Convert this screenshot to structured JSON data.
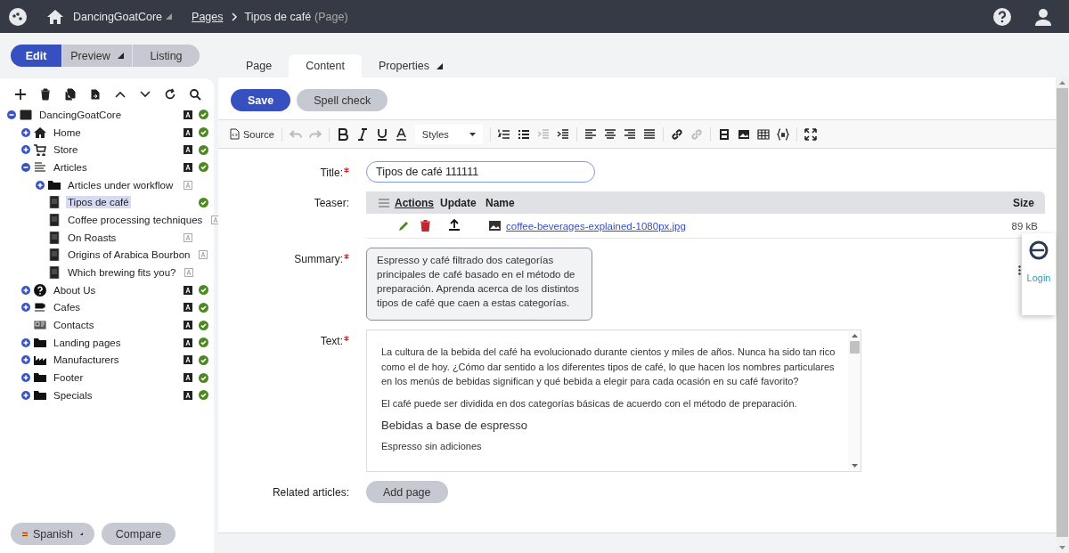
{
  "header": {
    "site": "DancingGoatCore",
    "breadcrumb": [
      {
        "label": "Pages",
        "kind": "link"
      },
      {
        "label": "Tipos de café",
        "kind": "current"
      }
    ],
    "page_type": "(Page)"
  },
  "mode_tabs": [
    {
      "label": "Edit",
      "selected": true,
      "dropdown": false
    },
    {
      "label": "Preview",
      "selected": false,
      "dropdown": true
    },
    {
      "label": "Listing",
      "selected": false,
      "dropdown": false
    }
  ],
  "tree": [
    {
      "label": "DancingGoatCore",
      "kind": "site",
      "expanded": true,
      "translated": true,
      "published": true,
      "selected": false,
      "children": [
        {
          "label": "Home",
          "kind": "home",
          "expanded": false,
          "translated": true,
          "published": true,
          "selected": false
        },
        {
          "label": "Store",
          "kind": "cart",
          "expanded": false,
          "translated": true,
          "published": true,
          "selected": false
        },
        {
          "label": "Articles",
          "kind": "list",
          "expanded": true,
          "translated": true,
          "published": true,
          "selected": false,
          "children": [
            {
              "label": "Articles under workflow",
              "kind": "folder",
              "expanded": false,
              "translated": false,
              "published": false,
              "selected": false
            },
            {
              "label": "Tipos de café",
              "kind": "page",
              "published": true,
              "selected": true
            },
            {
              "label": "Coffee processing techniques",
              "kind": "page",
              "translated": false,
              "published": false,
              "selected": false
            },
            {
              "label": "On Roasts",
              "kind": "page",
              "translated": false,
              "published": false,
              "selected": false
            },
            {
              "label": "Origins of Arabica Bourbon",
              "kind": "page",
              "translated": false,
              "published": false,
              "selected": false
            },
            {
              "label": "Which brewing fits you?",
              "kind": "page",
              "translated": false,
              "published": false,
              "selected": false
            }
          ]
        },
        {
          "label": "About Us",
          "kind": "question",
          "expanded": false,
          "translated": true,
          "published": true,
          "selected": false
        },
        {
          "label": "Cafes",
          "kind": "cup",
          "expanded": false,
          "translated": true,
          "published": true,
          "selected": false
        },
        {
          "label": "Contacts",
          "kind": "contact",
          "translated": true,
          "published": true,
          "selected": false
        },
        {
          "label": "Landing pages",
          "kind": "folder",
          "expanded": false,
          "translated": true,
          "published": true,
          "selected": false
        },
        {
          "label": "Manufacturers",
          "kind": "factory",
          "expanded": false,
          "translated": true,
          "published": true,
          "selected": false
        },
        {
          "label": "Footer",
          "kind": "folder",
          "expanded": false,
          "translated": true,
          "published": true,
          "selected": false
        },
        {
          "label": "Specials",
          "kind": "folder",
          "expanded": false,
          "translated": true,
          "published": true,
          "selected": false
        }
      ]
    }
  ],
  "footer_buttons": [
    {
      "label": "Spanish",
      "kind": "language"
    },
    {
      "label": "Compare",
      "kind": "plain"
    }
  ],
  "page_tabs": [
    {
      "label": "Page",
      "selected": false,
      "dropdown": false
    },
    {
      "label": "Content",
      "selected": true,
      "dropdown": false
    },
    {
      "label": "Properties",
      "selected": false,
      "dropdown": true
    }
  ],
  "actions": [
    {
      "label": "Save",
      "kind": "primary"
    },
    {
      "label": "Spell check",
      "kind": "secondary"
    }
  ],
  "editor_toolbar": [
    {
      "kind": "source",
      "label": "Source"
    },
    {
      "kind": "sep"
    },
    {
      "kind": "undo",
      "disabled": true
    },
    {
      "kind": "redo",
      "disabled": true
    },
    {
      "kind": "sep"
    },
    {
      "kind": "bold",
      "disabled": false
    },
    {
      "kind": "italic",
      "disabled": false
    },
    {
      "kind": "underline",
      "disabled": false
    },
    {
      "kind": "color",
      "disabled": false
    },
    {
      "kind": "styles",
      "label": "Styles"
    },
    {
      "kind": "sep"
    },
    {
      "kind": "ol",
      "disabled": false
    },
    {
      "kind": "ul",
      "disabled": false
    },
    {
      "kind": "outdent",
      "disabled": true
    },
    {
      "kind": "indent",
      "disabled": false
    },
    {
      "kind": "sep"
    },
    {
      "kind": "left",
      "disabled": false
    },
    {
      "kind": "center",
      "disabled": false
    },
    {
      "kind": "right",
      "disabled": false
    },
    {
      "kind": "justify",
      "disabled": false
    },
    {
      "kind": "sep"
    },
    {
      "kind": "link",
      "disabled": false
    },
    {
      "kind": "unlink",
      "disabled": true
    },
    {
      "kind": "sep"
    },
    {
      "kind": "film",
      "disabled": false
    },
    {
      "kind": "image",
      "disabled": false
    },
    {
      "kind": "table",
      "disabled": false
    },
    {
      "kind": "macro",
      "disabled": false
    },
    {
      "kind": "sep"
    },
    {
      "kind": "maximize",
      "disabled": false
    }
  ],
  "form": {
    "title": {
      "label": "Title:",
      "required": true,
      "value": "Tipos de café 111111"
    },
    "teaser": {
      "label": "Teaser:",
      "required": false,
      "columns": [
        "Actions",
        "Update",
        "Name",
        "Size"
      ],
      "file": {
        "name": "coffee-beverages-explained-1080px.jpg",
        "size": "89 kB"
      }
    },
    "summary": {
      "label": "Summary:",
      "required": true,
      "value": "Espresso y café filtrado dos categorías principales de café basado en el método de preparación. Aprenda acerca de los distintos tipos de café que caen a estas categorías."
    },
    "text": {
      "label": "Text:",
      "required": true,
      "blocks": [
        {
          "kind": "p",
          "text": "La cultura de la bebida del café ha evolucionado durante cientos y miles de años. Nunca ha sido tan rico como el de hoy. ¿Cómo dar sentido a los diferentes tipos de café, lo que hacen los nombres particulares en los menús de bebidas significan y qué bebida a elegir para cada ocasión en su café favorito?"
        },
        {
          "kind": "p",
          "text": "El café puede ser dividida en dos categorías básicas de acuerdo con el método de preparación."
        },
        {
          "kind": "h",
          "text": "Bebidas a base de espresso"
        },
        {
          "kind": "p",
          "text": "Espresso sin adiciones"
        }
      ]
    },
    "related": {
      "label": "Related articles:",
      "required": false,
      "button": "Add page"
    }
  },
  "widget": {
    "link": "Login"
  }
}
